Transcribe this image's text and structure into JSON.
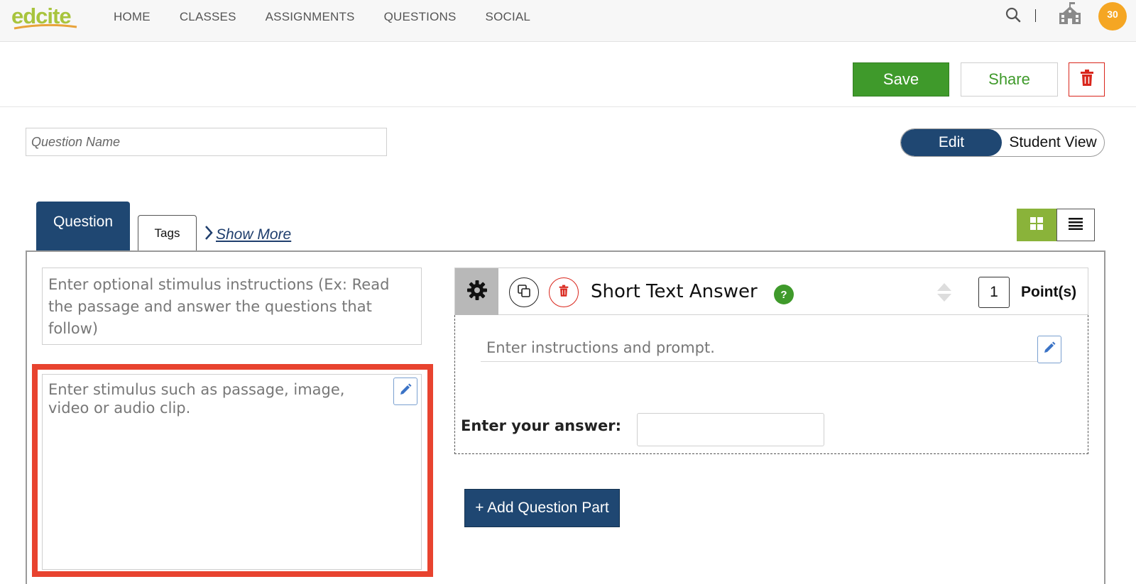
{
  "app": {
    "logo": "edcite"
  },
  "nav": {
    "items": [
      {
        "label": "HOME"
      },
      {
        "label": "CLASSES"
      },
      {
        "label": "ASSIGNMENTS"
      },
      {
        "label": "QUESTIONS"
      },
      {
        "label": "SOCIAL"
      }
    ],
    "notification_count": "30",
    "icons": [
      "search-icon",
      "school-icon"
    ]
  },
  "toolbar": {
    "save_label": "Save",
    "share_label": "Share",
    "delete_icon": "trash-icon"
  },
  "question_name": {
    "placeholder": "Question Name",
    "value": ""
  },
  "view_toggle": {
    "edit_label": "Edit",
    "student_view_label": "Student View",
    "selected": "Edit"
  },
  "tabs": {
    "question_label": "Question",
    "tags_label": "Tags",
    "show_more_label": "Show More"
  },
  "layout_toggle": {
    "grid_icon": "grid-icon",
    "list_icon": "list-icon",
    "selected": "grid"
  },
  "stimulus": {
    "instructions_placeholder": "Enter optional stimulus instructions (Ex: Read the passage and answer the questions that follow)",
    "content_placeholder": "Enter stimulus such as passage, image, video or audio clip."
  },
  "question_part": {
    "type_label": "Short Text Answer",
    "help_label": "?",
    "points_value": "1",
    "points_label": "Point(s)",
    "prompt_placeholder": "Enter instructions and prompt.",
    "answer_label": "Enter your answer:",
    "answer_value": ""
  },
  "add_part": {
    "label": "+ Add Question Part"
  },
  "colors": {
    "navy": "#1f4772",
    "green": "#3f9a2b",
    "highlight_red": "#e8432f",
    "grid_green": "#8ab33a",
    "badge_orange": "#f5a623"
  }
}
